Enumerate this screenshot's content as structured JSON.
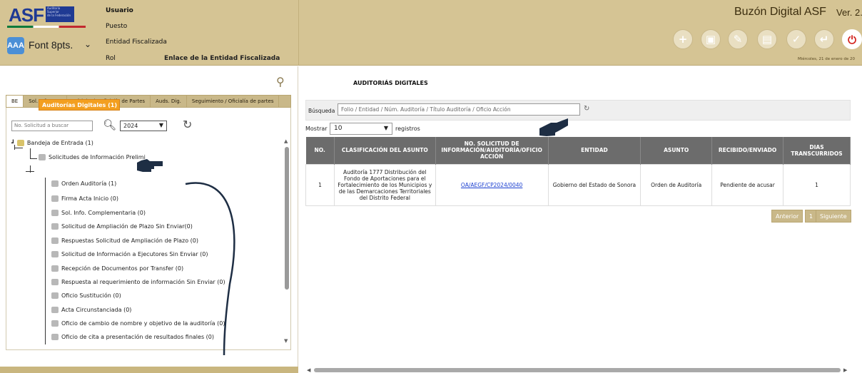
{
  "header": {
    "logo_text": "ASF",
    "logo_small_lines": [
      "Auditoría",
      "Superior",
      "de la Federación"
    ],
    "font_label": "Font 8pts.",
    "font_icon_text": "AAA",
    "user_fields": {
      "usuario": "Usuario",
      "puesto": "Puesto",
      "entidad": "Entidad Fiscalizada",
      "rol": "Rol",
      "rol_value": "Enlace de la Entidad Fiscalizada"
    },
    "brand": "Buzón Digital ASF",
    "version": "Ver. 2.",
    "date": "Miércoles, 21 de enero de 20",
    "toolbar_icons": [
      "plus-icon",
      "save-icon",
      "edit-icon",
      "trash-icon",
      "sign-icon",
      "return-icon",
      "power-icon"
    ]
  },
  "left": {
    "tabs": [
      "BE",
      "Sol. Info. Pre.",
      "Módulo de Oficialía de Partes",
      "Auds. Dig.",
      "Seguimiento / Oficialía de partes"
    ],
    "search_placeholder": "No. Solicitud a buscar",
    "year": "2024",
    "tree": {
      "root": "Bandeja de Entrada (1)",
      "node1": "Solicitudes de Información Prelimi",
      "selected": "Auditorías Digitales (1)",
      "children": [
        "Orden Auditoría (1)",
        "Firma Acta Inicio (0)",
        "Sol. Info. Complementaria (0)",
        "Solicitud de Ampliación de Plazo Sin Enviar(0)",
        "Respuestas Solicitud de Ampliación de Plazo (0)",
        "Solicitud de Información a Ejecutores Sin Enviar (0)",
        "Recepción de Documentos por Transfer (0)",
        "Respuesta al requerimiento de información Sin Enviar (0)",
        "Oficio Sustitución (0)",
        "Acta Circunstanciada (0)",
        "Oficio de cambio de nombre y objetivo de la auditoría (0)",
        "Oficio de cita a presentación de resultados finales (0)"
      ]
    }
  },
  "right": {
    "title": "AUDITORIÁS DIGITALES",
    "search_label": "Búsqueda",
    "search_placeholder": "Folio / Entidad / Núm. Auditoría / Título Auditoría / Oficio Acción",
    "show_label": "Mostrar",
    "show_value": "10",
    "records_label": "registros",
    "columns": {
      "no": "NO.",
      "clasif": "CLASIFICACIÓN DEL ASUNTO",
      "sol": "NO. SOLICITUD DE INFORMACIÓN/AUDITORÍA/OFICIO ACCIÓN",
      "entidad": "ENTIDAD",
      "asunto": "ASUNTO",
      "recibido": "RECIBIDO/ENVIADO",
      "dias": "DIAS TRANSCURRIDOS"
    },
    "row": {
      "no": "1",
      "clasif": "Auditoría 1777 Distribución del Fondo de Aportaciones para el Fortalecimiento de los Municipios y de las Demarcaciones Territoriales del Distrito Federal",
      "sol": "OA/AEGF/CP2024/0040",
      "entidad": "Gobierno del Estado de Sonora",
      "asunto": "Orden de Auditoría",
      "recibido": "Pendiente de acusar",
      "dias": "1"
    },
    "pager": {
      "prev": "Anterior",
      "page": "1",
      "next": "Siguiente"
    }
  }
}
